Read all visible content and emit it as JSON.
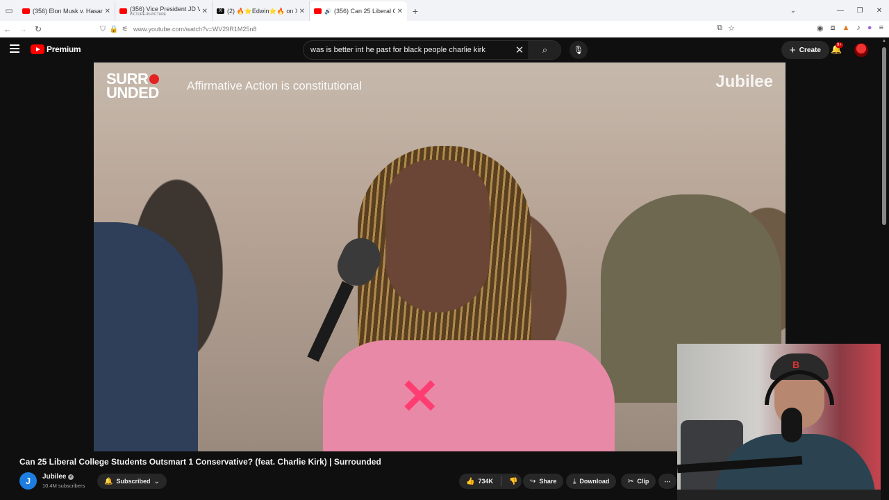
{
  "browser": {
    "tabs": [
      {
        "title": "(356) Elon Musk v. Hasan Piker",
        "subtitle": "",
        "type": "youtube",
        "active": false
      },
      {
        "title": "(356) Vice President JD Vance R",
        "subtitle": "PICTURE-IN-PICTURE",
        "type": "youtube",
        "active": false
      },
      {
        "title": "(2) 🔥⭐Edwin⭐🔥 on X: \"Is Ti",
        "subtitle": "",
        "type": "x",
        "active": false
      },
      {
        "title": "(356) Can 25 Liberal Colleg",
        "subtitle": "",
        "type": "youtube",
        "active": true
      }
    ],
    "url": "www.youtube.com/watch?v=WV29R1M25n8"
  },
  "youtube": {
    "logo_text": "Premium",
    "search_value": "was is better int he past for black people charlie kirk",
    "create_label": "Create",
    "notification_badge": "9+"
  },
  "video_overlay": {
    "show_logo_line1": "SURR",
    "show_logo_line2": "UNDED",
    "caption": "Affirmative Action is constitutional",
    "brand": "Jubilee"
  },
  "video": {
    "title": "Can 25 Liberal College Students Outsmart 1 Conservative? (feat. Charlie Kirk) | Surrounded",
    "channel_name": "Jubilee",
    "channel_initial": "J",
    "subscribers": "10.4M subscribers",
    "subscribed_label": "Subscribed",
    "likes": "734K",
    "share_label": "Share",
    "download_label": "Download",
    "clip_label": "Clip"
  },
  "colors": {
    "yt_red": "#ff0000",
    "bg": "#0f0f0f",
    "pill": "#272727"
  }
}
